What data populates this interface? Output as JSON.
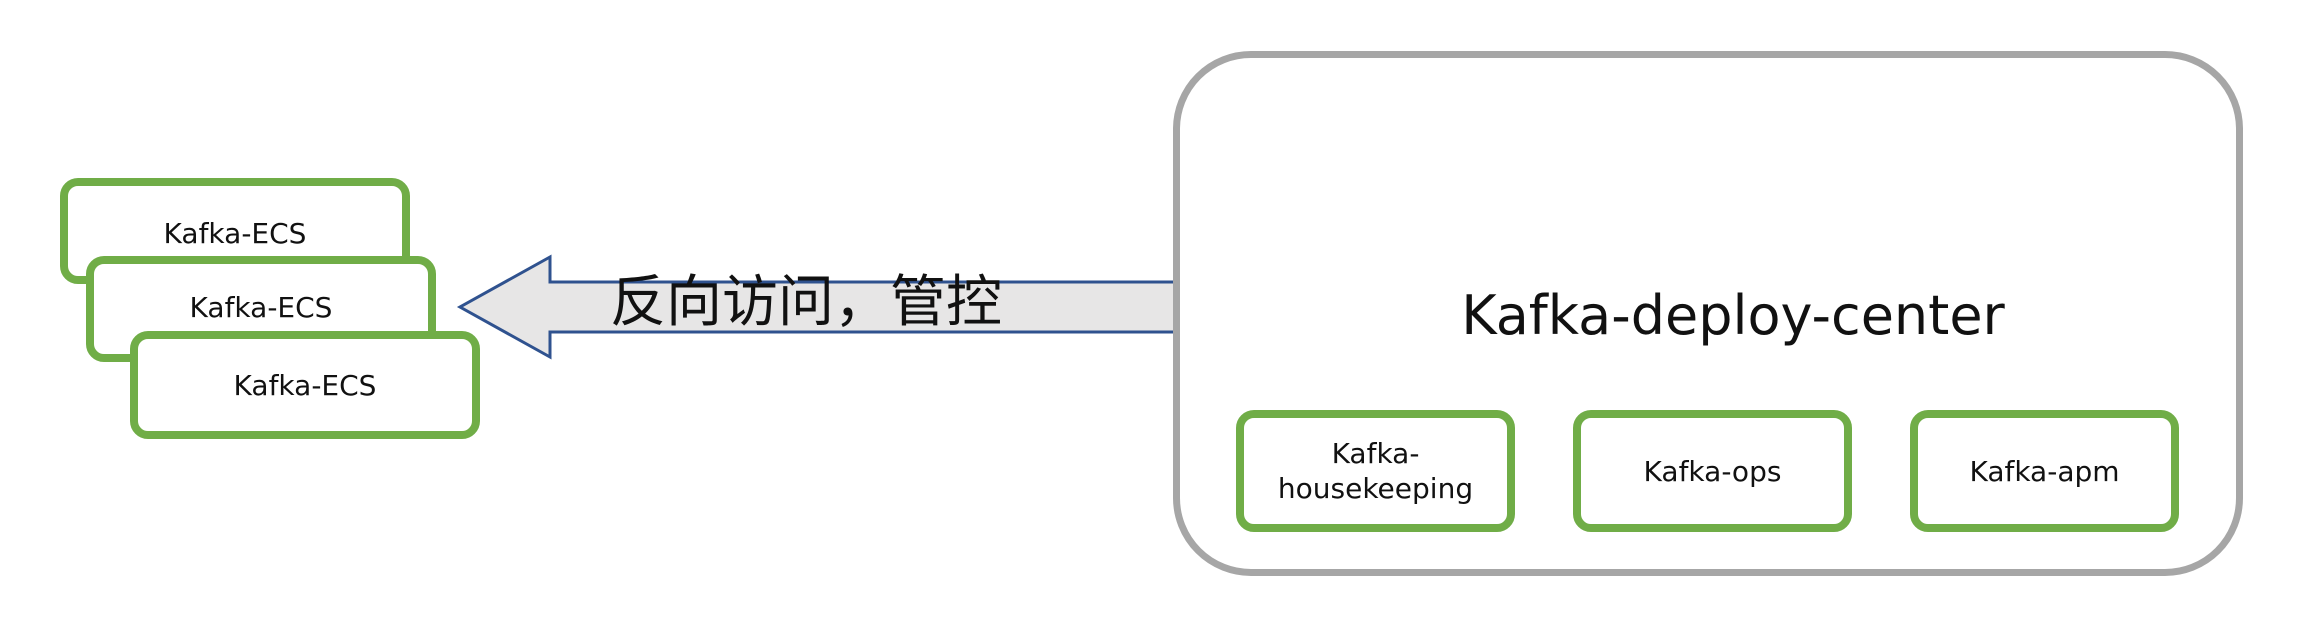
{
  "edge_label": "反向访问，管控",
  "ecs_nodes": [
    {
      "label": "Kafka-ECS"
    },
    {
      "label": "Kafka-ECS"
    },
    {
      "label": "Kafka-ECS"
    }
  ],
  "center": {
    "title": "Kafka-deploy-center",
    "modules": [
      {
        "label": "Kafka-\nhousekeeping"
      },
      {
        "label": "Kafka-ops"
      },
      {
        "label": "Kafka-apm"
      }
    ]
  },
  "colors": {
    "node_border": "#70ad47",
    "container_border": "#a6a6a6",
    "arrow_fill": "#e7e6e6",
    "arrow_stroke": "#2f528f"
  }
}
